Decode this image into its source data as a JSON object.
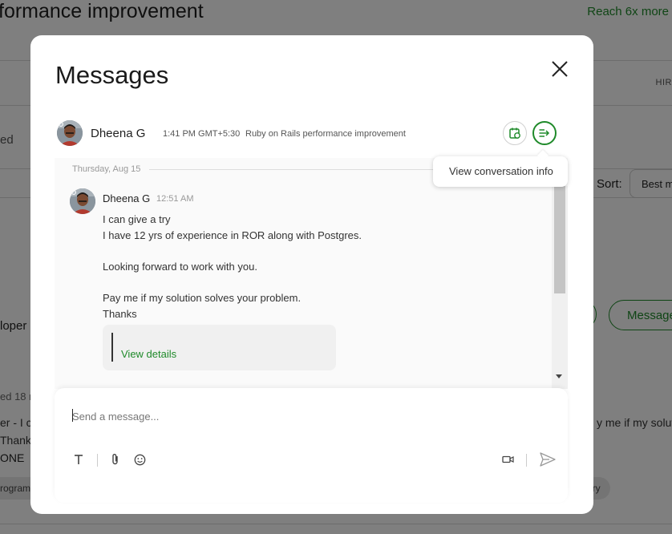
{
  "background": {
    "title": "formance improvement",
    "reach_text": "Reach 6x more",
    "hir_text": "HIR",
    "ed_text": "ed",
    "sort_label": "Sort:",
    "sort_value": "Best m",
    "message_btn": "Message",
    "oper_text": "loper",
    "ed18_text": "ed 18 m",
    "er_text": "er - I c",
    "thanks_text": "Thanks",
    "one_text": "ONE",
    "solu_text": "y me if my solut",
    "program_tag": "rogram",
    "ery_tag": "ery"
  },
  "modal": {
    "title": "Messages",
    "header": {
      "name": "Dheena G",
      "time": "1:41 PM GMT+5:30",
      "topic": "Ruby on Rails performance improvement"
    },
    "tooltip": "View conversation info",
    "date_divider": "Thursday, Aug 15",
    "message": {
      "sender": "Dheena G",
      "time": "12:51 AM",
      "lines": [
        "I can give a try",
        "I have 12 yrs of experience in ROR along with Postgres.",
        "",
        "Looking forward to work with you.",
        "",
        "Pay me if my solution solves your problem.",
        "Thanks"
      ],
      "attachment_link": "View details"
    },
    "composer": {
      "placeholder": "Send a message..."
    }
  },
  "colors": {
    "accent_green": "#1f8a2a",
    "overlay": "rgba(0,0,0,0.5)"
  }
}
